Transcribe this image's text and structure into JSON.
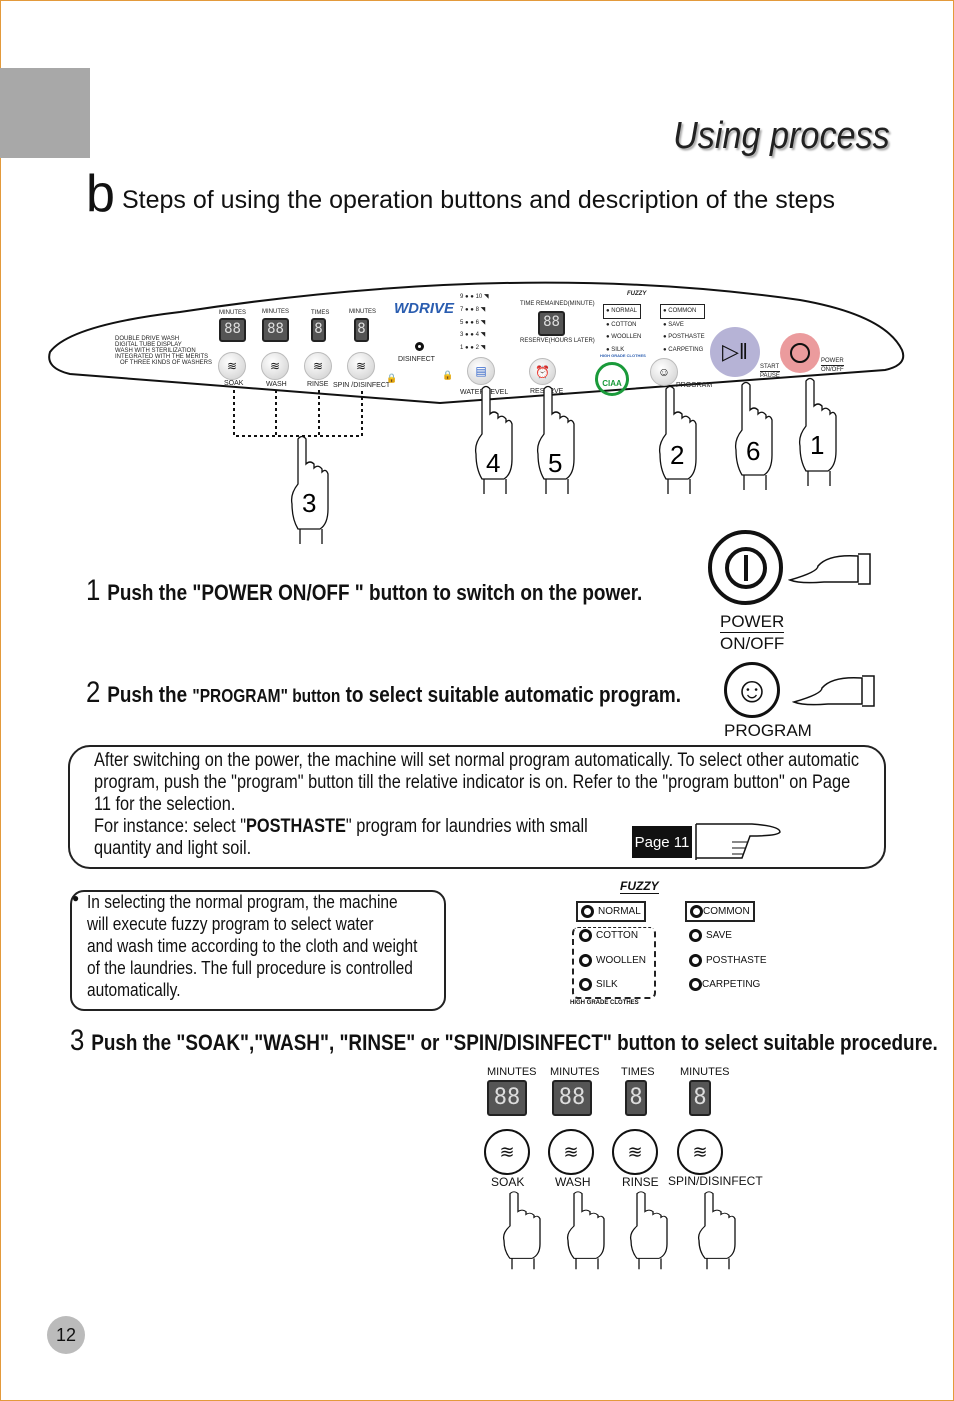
{
  "header": {
    "title": "Using process",
    "section_letter": "b",
    "subtitle": "Steps of using the operation buttons and description of  the steps"
  },
  "panel": {
    "features": [
      "DOUBLE DRIVE WASH",
      "DIGITAL TUBE DISPLAY",
      "WASH WITH STERILIZATION",
      "INTEGRATED WITH THE MERITS",
      "OF THREE KINDS OF WASHERS"
    ],
    "displays": [
      {
        "unit": "MINUTES",
        "value": "88"
      },
      {
        "unit": "MINUTES",
        "value": "88"
      },
      {
        "unit": "TIMES",
        "value": "8"
      },
      {
        "unit": "MINUTES",
        "value": "8"
      }
    ],
    "buttons": [
      "SOAK",
      "WASH",
      "RINSE",
      "SPIN /DISINFECT"
    ],
    "brand": "WDRIVE",
    "disinfect": "DISINFECT",
    "water_levels": [
      "9",
      "10",
      "7",
      "8",
      "5",
      "6",
      "3",
      "4",
      "1",
      "2"
    ],
    "water_level": "WATER LEVEL",
    "time_remained": "TIME REMAINED(MINUTE)",
    "time_display": "88",
    "reserve_hours": "RESERVE(HOURS LATER)",
    "reserve": "RESERVE",
    "fuzzy": "FUZZY",
    "programs_left": [
      "NORMAL",
      "COTTON",
      "WOOLLEN",
      "SILK"
    ],
    "programs_right": [
      "COMMON",
      "SAVE",
      "POSTHASTE",
      "CARPETING"
    ],
    "high_grade": "HIGH GRADE CLOTHES",
    "ciaa": "CIAA",
    "program": "PROGRAM",
    "start": "START",
    "pause": "PAUSE",
    "power": "POWER",
    "onoff": "ON/OFF",
    "hand_numbers": [
      "3",
      "4",
      "5",
      "2",
      "6",
      "1"
    ]
  },
  "step1": {
    "num": "1",
    "text": "Push the \"POWER ON/OFF  \" button to switch on the power.",
    "label1": "POWER",
    "label2": "ON/OFF"
  },
  "step2": {
    "num": "2",
    "text_a": "Push the ",
    "text_b": "\"PROGRAM\" button",
    "text_c": " to select suitable automatic program.",
    "label": "PROGRAM"
  },
  "info_box": {
    "lines": [
      "After switching on the power, the machine will set normal program automatically. To select other automatic",
      "program, push the \"program\" button till the relative indicator is on. Refer to the \"program button\" on Page",
      "11 for the selection."
    ],
    "instance_a": "For instance: select \"",
    "instance_bold": "POSTHASTE",
    "instance_b": "\" program for laundries with small",
    "last": "quantity and light soil.",
    "page_ref": "Page 11"
  },
  "note_box": {
    "lines": [
      "In selecting the  normal  program,  the machine",
      "will execute fuzzy program to select water",
      "and wash time according to the cloth and weight",
      "of the laundries. The full procedure is controlled",
      "automatically."
    ]
  },
  "step3": {
    "num": "3",
    "text": "Push the  \"SOAK\",\"WASH\", \"RINSE\" or \"SPIN/DISINFECT\" button to select suitable procedure.",
    "displays": [
      {
        "unit": "MINUTES",
        "value": "88"
      },
      {
        "unit": "MINUTES",
        "value": "88"
      },
      {
        "unit": "TIMES",
        "value": "8"
      },
      {
        "unit": "MINUTES",
        "value": "8"
      }
    ],
    "buttons": [
      "SOAK",
      "WASH",
      "RINSE",
      "SPIN/DISINFECT"
    ]
  },
  "page_number": "12"
}
